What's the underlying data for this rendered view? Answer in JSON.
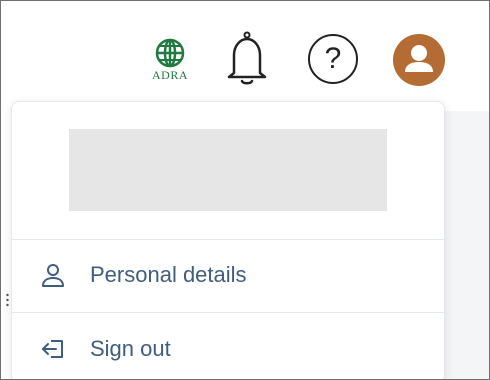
{
  "header": {
    "logo_text": "ADRA",
    "icons": {
      "logo": "adra-globe-logo",
      "bell": "bell-icon",
      "help": "help-icon",
      "avatar": "user-avatar-icon"
    },
    "help_symbol": "?"
  },
  "colors": {
    "avatar_bg": "#b56b34",
    "logo_green": "#1f7a3f",
    "menu_text": "#3f5d7f"
  },
  "profile_menu": {
    "profile_name": "",
    "items": [
      {
        "label": "Personal details",
        "icon": "person-icon"
      },
      {
        "label": "Sign out",
        "icon": "sign-out-icon"
      }
    ]
  }
}
